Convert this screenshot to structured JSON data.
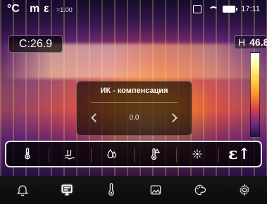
{
  "statusbar": {
    "unit": "°C",
    "mode": "m",
    "eps_symbol": "ε",
    "eps_value": "=1.00",
    "time": "17:11",
    "icons": [
      "sd-card-icon",
      "wifi-icon",
      "battery-icon"
    ]
  },
  "readout": {
    "center": "C:26.9",
    "high_label": "H",
    "high_value": "46.8"
  },
  "dialog": {
    "title": "ИК - компенсация",
    "value": "0.0"
  },
  "strip": {
    "icons": [
      "thermometer-icon",
      "humidity-icon",
      "droplet-icon",
      "thermometer-delta-icon",
      "laser-icon",
      "emissivity-icon"
    ],
    "emissivity_label": "ε↑"
  },
  "nav": {
    "items": [
      "bell-icon",
      "monitor-icon",
      "thermometer-icon",
      "image-icon",
      "palette-icon",
      "gear-icon"
    ],
    "active_index": 1
  },
  "colors": {
    "scale_top": "#ffffff",
    "scale_bottom": "#1c1240",
    "accent": "#ffffff"
  }
}
